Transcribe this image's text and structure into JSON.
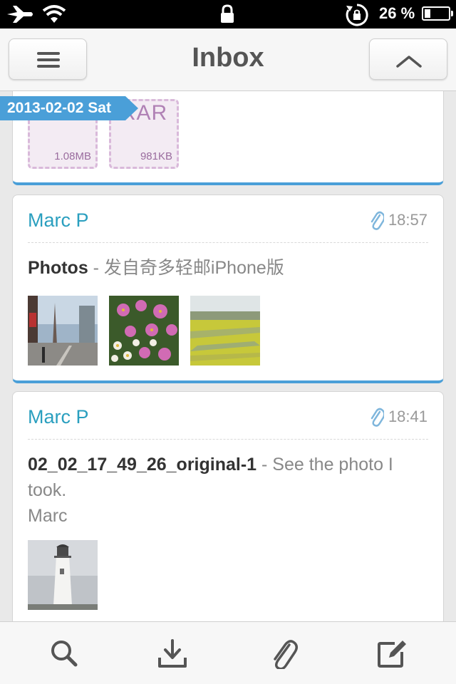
{
  "status_bar": {
    "battery_percent": "26 %",
    "battery_level": 0.26
  },
  "nav": {
    "title": "Inbox"
  },
  "date_header": "2013-02-02 Sat",
  "attachments": [
    {
      "type": "RAR",
      "size": "1.08MB"
    },
    {
      "type": "RAR",
      "size": "981KB"
    }
  ],
  "messages": [
    {
      "sender": "Marc P",
      "time": "18:57",
      "subject": "Photos",
      "preview": " - 发自奇多轻邮iPhone版"
    },
    {
      "sender": "Marc P",
      "time": "18:41",
      "subject": "02_02_17_49_26_original-1",
      "preview": " - See the photo I took.",
      "preview2": "Marc"
    }
  ],
  "colors": {
    "accent": "#4a9fd8",
    "sender": "#2a9fbf",
    "rar": "#b081b5"
  },
  "toolbar": [
    "search-icon",
    "download-icon",
    "paperclip-icon",
    "compose-icon"
  ]
}
